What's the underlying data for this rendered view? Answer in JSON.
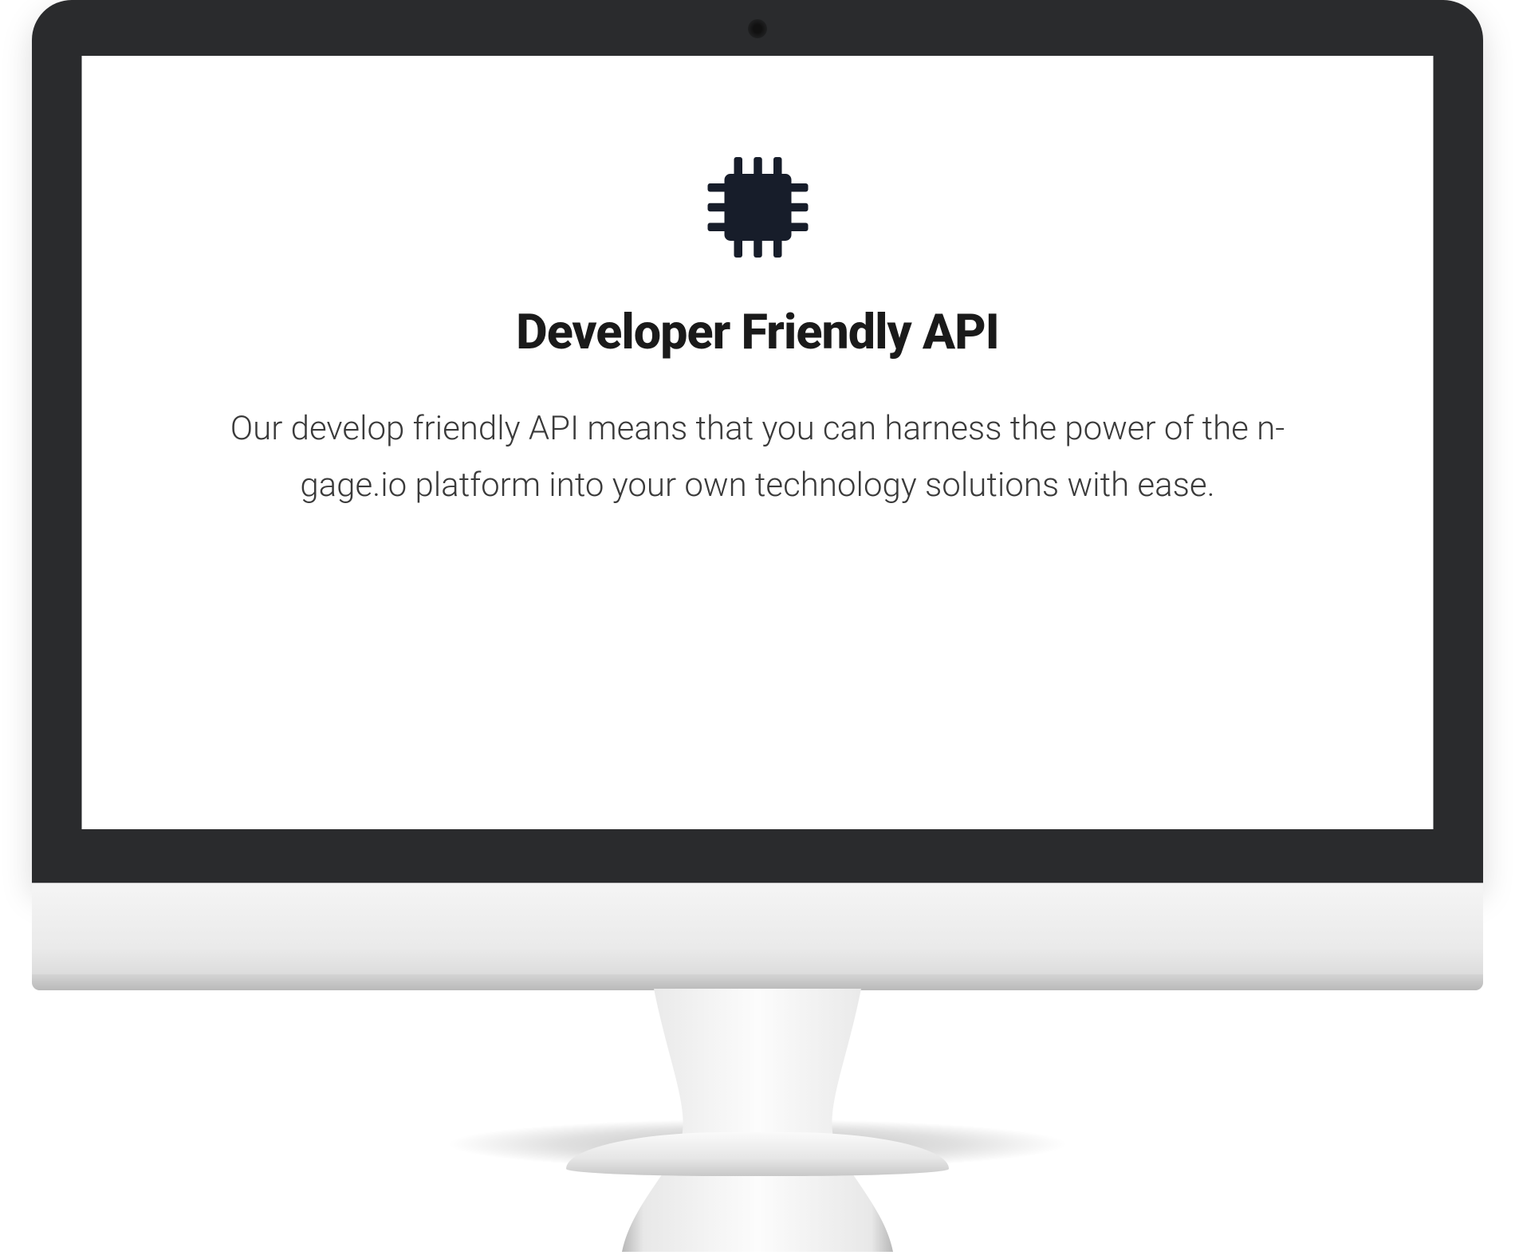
{
  "content": {
    "headline": "Developer Friendly API",
    "body": "Our develop friendly API means that you can harness the power of the n-gage.io platform into your own technology solutions with ease.",
    "icon_name": "chip-icon"
  },
  "colors": {
    "bezel": "#2a2b2d",
    "text_dark": "#1a1a1a",
    "text_body": "#3a3a3a"
  }
}
